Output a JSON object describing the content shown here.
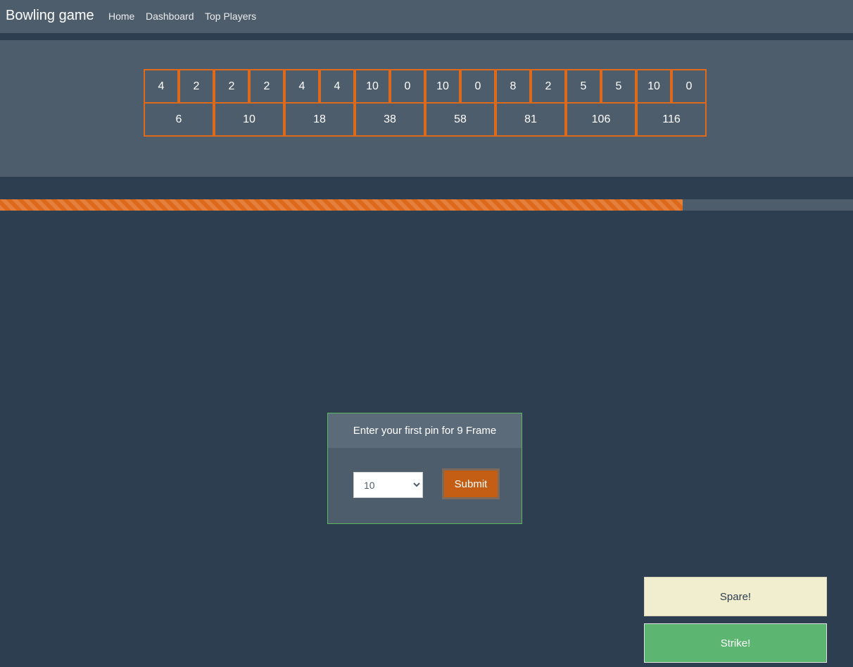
{
  "navbar": {
    "brand": "Bowling game",
    "links": [
      "Home",
      "Dashboard",
      "Top Players"
    ]
  },
  "scoreboard": {
    "rolls": [
      "4",
      "2",
      "2",
      "2",
      "4",
      "4",
      "10",
      "0",
      "10",
      "0",
      "8",
      "2",
      "5",
      "5",
      "10",
      "0"
    ],
    "totals": [
      "6",
      "10",
      "18",
      "38",
      "58",
      "81",
      "106",
      "116"
    ]
  },
  "progress": {
    "fraction": 0.8
  },
  "pin_entry": {
    "prompt": "Enter your first pin for 9 Frame",
    "selected_value": "10",
    "submit_label": "Submit"
  },
  "actions": {
    "spare_label": "Spare!",
    "strike_label": "Strike!"
  },
  "colors": {
    "background": "#2c3e50",
    "panel": "#4e5d6c",
    "accent": "#df691a",
    "success": "#5cb85c"
  }
}
